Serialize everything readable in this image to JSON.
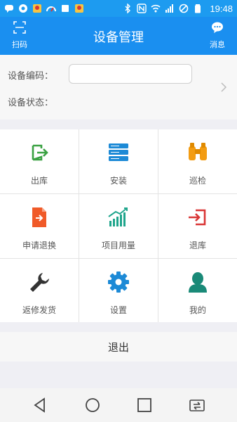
{
  "status_bar": {
    "time": "19:48",
    "icons": [
      "chat-bubble-icon",
      "camera-icon",
      "map-pin-icon",
      "gauge-icon",
      "square-icon",
      "map-pin-icon",
      "bluetooth-icon",
      "nfc-icon",
      "wifi-icon",
      "signal-icon",
      "no-sim-icon",
      "battery-icon"
    ]
  },
  "app_bar": {
    "title": "设备管理",
    "left_label": "扫码",
    "right_label": "消息"
  },
  "form": {
    "code_label": "设备编码：",
    "code_value": "",
    "code_placeholder": "",
    "status_label": "设备状态：",
    "status_value": ""
  },
  "grid": [
    {
      "label": "出库",
      "icon": "export-icon",
      "color": "#3aa142"
    },
    {
      "label": "安装",
      "icon": "server-stack-icon",
      "color": "#1d8ad6"
    },
    {
      "label": "巡检",
      "icon": "binoculars-icon",
      "color": "#f39c12"
    },
    {
      "label": "申请退换",
      "icon": "document-arrow-icon",
      "color": "#f05a28"
    },
    {
      "label": "项目用量",
      "icon": "bar-trend-icon",
      "color": "#1fa58c"
    },
    {
      "label": "退库",
      "icon": "import-icon",
      "color": "#d93636"
    },
    {
      "label": "返修发货",
      "icon": "wrench-icon",
      "color": "#333333"
    },
    {
      "label": "设置",
      "icon": "gear-icon",
      "color": "#1d8ad6"
    },
    {
      "label": "我的",
      "icon": "user-icon",
      "color": "#1a8a78"
    }
  ],
  "logout_label": "退出",
  "colors": {
    "primary": "#1a8ff0",
    "background": "#efeff4"
  }
}
